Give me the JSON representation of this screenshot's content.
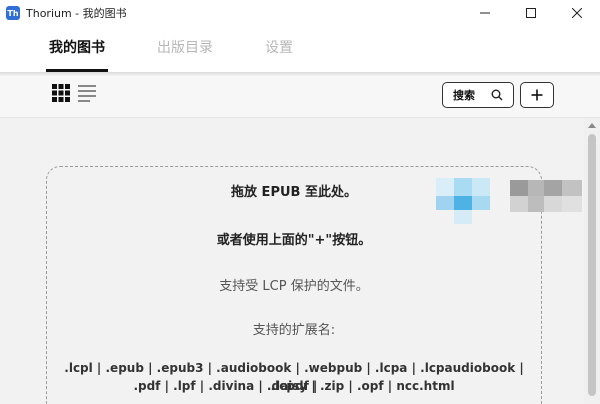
{
  "window": {
    "app_icon_text": "Th",
    "title": "Thorium - 我的图书"
  },
  "tabs": [
    {
      "label": "我的图书",
      "active": true
    },
    {
      "label": "出版目录",
      "active": false
    },
    {
      "label": "设置",
      "active": false
    }
  ],
  "toolbar": {
    "search_label": "搜索",
    "add_label": "+"
  },
  "dropzone": {
    "line1": "拖放 EPUB 至此处。",
    "line2": "或者使用上面的\"+\"按钮。",
    "line3": "支持受 LCP 保护的文件。",
    "line4": "支持的扩展名:",
    "extensions_line1": ".lcpl | .epub | .epub3 | .audiobook | .webpub | .lcpa | .lcpaudiobook | .lcpdf |",
    "extensions_line2": ".pdf | .lpf | .divina | .daisy | .zip | .opf | ncc.html"
  }
}
